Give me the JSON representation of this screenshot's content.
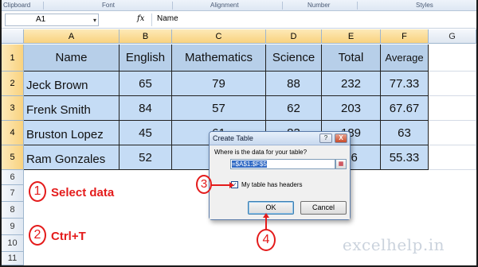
{
  "ribbon": {
    "groups": [
      "Clipboard",
      "Font",
      "Alignment",
      "Number",
      "Styles"
    ]
  },
  "formula_bar": {
    "name_box": "A1",
    "fx_label": "fx",
    "value": "Name"
  },
  "columns": [
    "A",
    "B",
    "C",
    "D",
    "E",
    "F",
    "G"
  ],
  "rows": [
    "1",
    "2",
    "3",
    "4",
    "5",
    "6",
    "7",
    "8",
    "9",
    "10",
    "11"
  ],
  "table": {
    "headers": [
      "Name",
      "English",
      "Mathematics",
      "Science",
      "Total",
      "Average"
    ],
    "rows": [
      [
        "Jeck Brown",
        "65",
        "79",
        "88",
        "232",
        "77.33"
      ],
      [
        "Frenk Smith",
        "84",
        "57",
        "62",
        "203",
        "67.67"
      ],
      [
        "Bruston Lopez",
        "45",
        "61",
        "83",
        "189",
        "63"
      ],
      [
        "Ram Gonzales",
        "52",
        "",
        "",
        "66",
        "55.33"
      ]
    ]
  },
  "annotations": {
    "step1_num": "1",
    "step1_text": "Select data",
    "step2_num": "2",
    "step2_text": "Ctrl+T",
    "step3_num": "3",
    "step4_num": "4"
  },
  "dialog": {
    "title": "Create Table",
    "help": "?",
    "close": "X",
    "question": "Where is the data for your table?",
    "range": "=$A$1:$F$5",
    "checkbox_checked": true,
    "checkbox_mark": "✓",
    "checkbox_label": "My table has headers",
    "ok": "OK",
    "cancel": "Cancel"
  },
  "watermark": "excelhelp.in",
  "colors": {
    "annotation": "#e41b1b",
    "table_fill": "#c5dcf5",
    "header_fill": "#b7cfe9"
  }
}
